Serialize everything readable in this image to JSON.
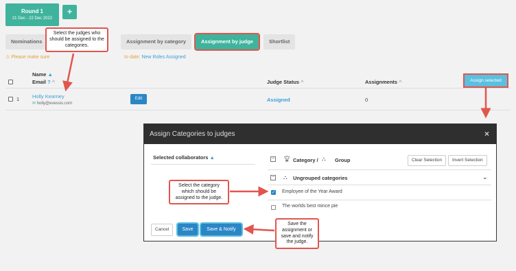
{
  "round": {
    "label": "Round 1",
    "dates": "21 Dec - 22 Dec 2022"
  },
  "add_round_label": "+",
  "tabs": [
    "Nominations",
    "Assignment by category",
    "Assignment by judge",
    "Shortlist"
  ],
  "warning": {
    "icon": "warning-icon",
    "text": "Please make sure ",
    "tail": "to date: ",
    "link": "New Roles Assigned"
  },
  "table": {
    "headers": {
      "name": "Name",
      "email": "Email",
      "judge_status": "Judge Status",
      "assignments": "Assignments"
    },
    "assign_selected": "Assign selected",
    "rows": [
      {
        "index": "1",
        "name": "Holly Kearney",
        "email": "holly@evessis.com",
        "edit": "Edit",
        "status": "Assigned",
        "assignments": "0"
      }
    ]
  },
  "modal": {
    "title": "Assign Categories to judges",
    "close": "×",
    "selected_collaborators": "Selected collaborators",
    "col_category": "Category /",
    "col_group": "Group",
    "clear_selection": "Clear Selection",
    "invert_selection": "Invert Selection",
    "group_name": "Ungrouped categories",
    "categories": [
      {
        "name": "Employee of the Year Award",
        "checked": true
      },
      {
        "name": "The worlds best mince pie",
        "checked": false
      }
    ],
    "cancel": "Cancel",
    "save": "Save",
    "save_notify": "Save & Notify"
  },
  "callouts": {
    "select_judges": "Select the judges who should be assigned to the categories.",
    "select_category": "Select the category which should be assigned to the judge.",
    "save_notify": "Save the assignment or save and notify the judge."
  },
  "colors": {
    "accent": "#3fb39b",
    "link": "#3a9fd6",
    "button_blue": "#2b86c5",
    "callout_border": "#e0554e",
    "warning": "#e3a23a"
  }
}
